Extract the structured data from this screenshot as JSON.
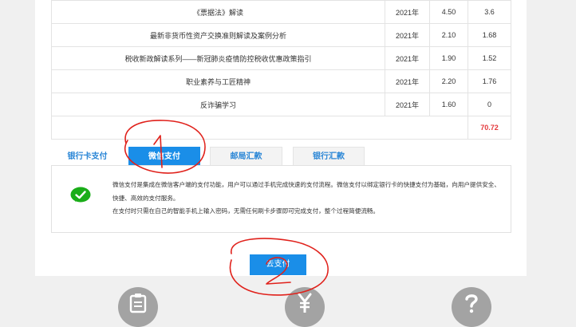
{
  "courses": [
    {
      "title": "《票据法》解读",
      "year": "2021年",
      "price": "4.50",
      "discount": "3.6"
    },
    {
      "title": "最新非货币性资产交换准则解读及案例分析",
      "year": "2021年",
      "price": "2.10",
      "discount": "1.68"
    },
    {
      "title": "税收新政解读系列——新冠肺炎疫情防控税收优惠政策指引",
      "year": "2021年",
      "price": "1.90",
      "discount": "1.52"
    },
    {
      "title": "职业素养与工匠精神",
      "year": "2021年",
      "price": "2.20",
      "discount": "1.76"
    },
    {
      "title": "反诈骗学习",
      "year": "2021年",
      "price": "1.60",
      "discount": "0"
    }
  ],
  "total": "70.72",
  "payment_tabs": [
    {
      "label": "银行卡支付",
      "active": false
    },
    {
      "label": "微信支付",
      "active": true
    },
    {
      "label": "邮局汇款",
      "active": false
    },
    {
      "label": "银行汇款",
      "active": false
    }
  ],
  "wechat_info": {
    "line1": "微信支付是集成在微信客户端的支付功能，用户可以通过手机完成快速的支付流程。微信支付以绑定银行卡的快捷支付为基础，向用户提供安全、快捷、高效的支付服务。",
    "line2": "在支付时只需在自己的智能手机上输入密码，无需任何刷卡步骤即可完成支付，整个过程简便流畅。"
  },
  "go_pay_label": "去支付",
  "footer_icons": [
    "clipboard-icon",
    "yuan-icon",
    "question-icon"
  ],
  "colors": {
    "accent": "#1a8ee8",
    "total": "#e4393c",
    "annotation": "#e0211b",
    "wechat": "#1aad19"
  }
}
